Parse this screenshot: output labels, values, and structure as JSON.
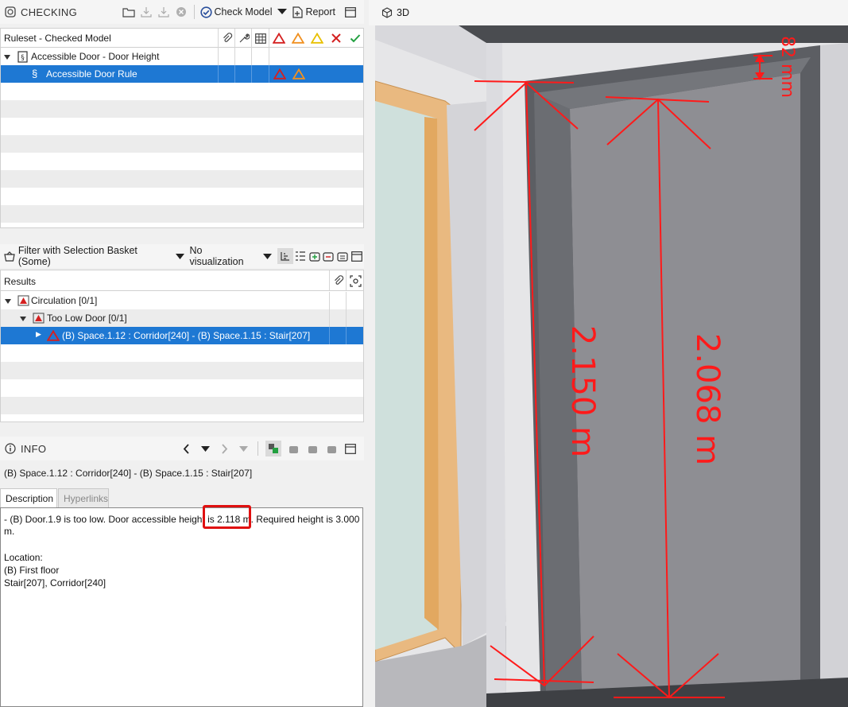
{
  "checking": {
    "title": "CHECKING",
    "check_model_label": "Check Model",
    "report_label": "Report",
    "columns": {
      "ruleset": "Ruleset - Checked Model"
    },
    "rows": [
      {
        "label": "Accessible Door - Door Height"
      },
      {
        "label": "Accessible Door Rule"
      }
    ]
  },
  "results": {
    "filter_label": "Filter with Selection Basket (Some)",
    "visualization_label": "No visualization",
    "column": "Results",
    "rows": [
      {
        "label": "Circulation [0/1]"
      },
      {
        "label": "Too Low Door [0/1]"
      },
      {
        "label": "(B) Space.1.12 : Corridor[240] - (B) Space.1.15 : Stair[207]"
      }
    ]
  },
  "info": {
    "title": "INFO",
    "subject": "(B) Space.1.12 : Corridor[240] - (B) Space.1.15 : Stair[207]",
    "tabs": [
      "Description",
      "Hyperlinks"
    ],
    "description": {
      "line1_prefix": "- (B) Door.1.9 is too low. Door accessible height is ",
      "highlight": "2.118 m.",
      "line1_suffix": " Required height is 3.000",
      "line2": "m.",
      "location_label": "Location:",
      "floor": "(B) First floor",
      "spaces": "Stair[207], Corridor[240]"
    }
  },
  "viewport": {
    "title": "3D",
    "dimensions": {
      "outer_height": "2.150 m",
      "inner_height": "2.068 m",
      "gap": "82 mm"
    }
  },
  "colors": {
    "selection": "#1e78d3",
    "dimension": "#ff1a1a",
    "error": "#d42020",
    "warning": "#f09020",
    "info": "#e8c000",
    "ok": "#22a040",
    "wall": "#c8c8cc",
    "frame": "#55575c",
    "door": "#8e8e93",
    "window_frame": "#e8b878",
    "glass": "#cfe0dc"
  }
}
